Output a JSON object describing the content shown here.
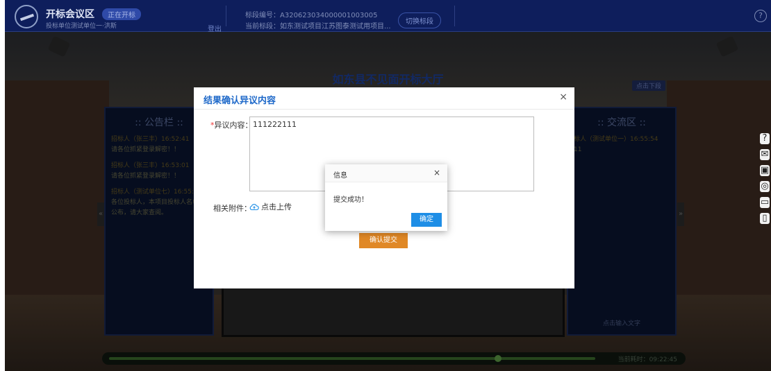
{
  "header": {
    "title": "开标会议区",
    "badge": "正在开标",
    "subtitle": "投标单位测试单位一·洪斯",
    "logout": "登出",
    "bid_number": "标段编号：A320623034000001003005",
    "current_section": "当前标段：如东测试项目江苏图泰测试用项目...",
    "switch_section": "切换标段"
  },
  "hall": {
    "title": "如东县不见面开标大厅",
    "next_button": "点击下段"
  },
  "announcement": {
    "title": ":: 公告栏 ::",
    "messages": [
      {
        "header": "招标人（张三丰）16:52:41",
        "text": "请各位抓紧登录解密！！"
      },
      {
        "header": "招标人（张三丰）16:53:01",
        "text": "请各位抓紧登录解密！！"
      },
      {
        "header": "招标人（测试单位七）16:55:2",
        "text": "各位投标人，本项目投标人名单已公布，请大家查阅。"
      }
    ]
  },
  "exchange": {
    "title": ":: 交流区 ::",
    "messages": [
      {
        "header": "标人（测试单位一）16:55:54",
        "text": "11"
      }
    ],
    "input_hint": "点击输入文字"
  },
  "progress": {
    "time": "当前耗时：09:22:45",
    "fraction": 0.8
  },
  "dialog": {
    "title": "结果确认异议内容",
    "field_label": "异议内容：",
    "required_mark": "*",
    "field_value": "111222111",
    "attach_label": "相关附件：",
    "upload_text": "点击上传",
    "submit": "确认提交"
  },
  "popup": {
    "title": "信息",
    "message": "提交成功！",
    "ok": "确定"
  },
  "icons": {
    "close": "×",
    "help": "?"
  }
}
